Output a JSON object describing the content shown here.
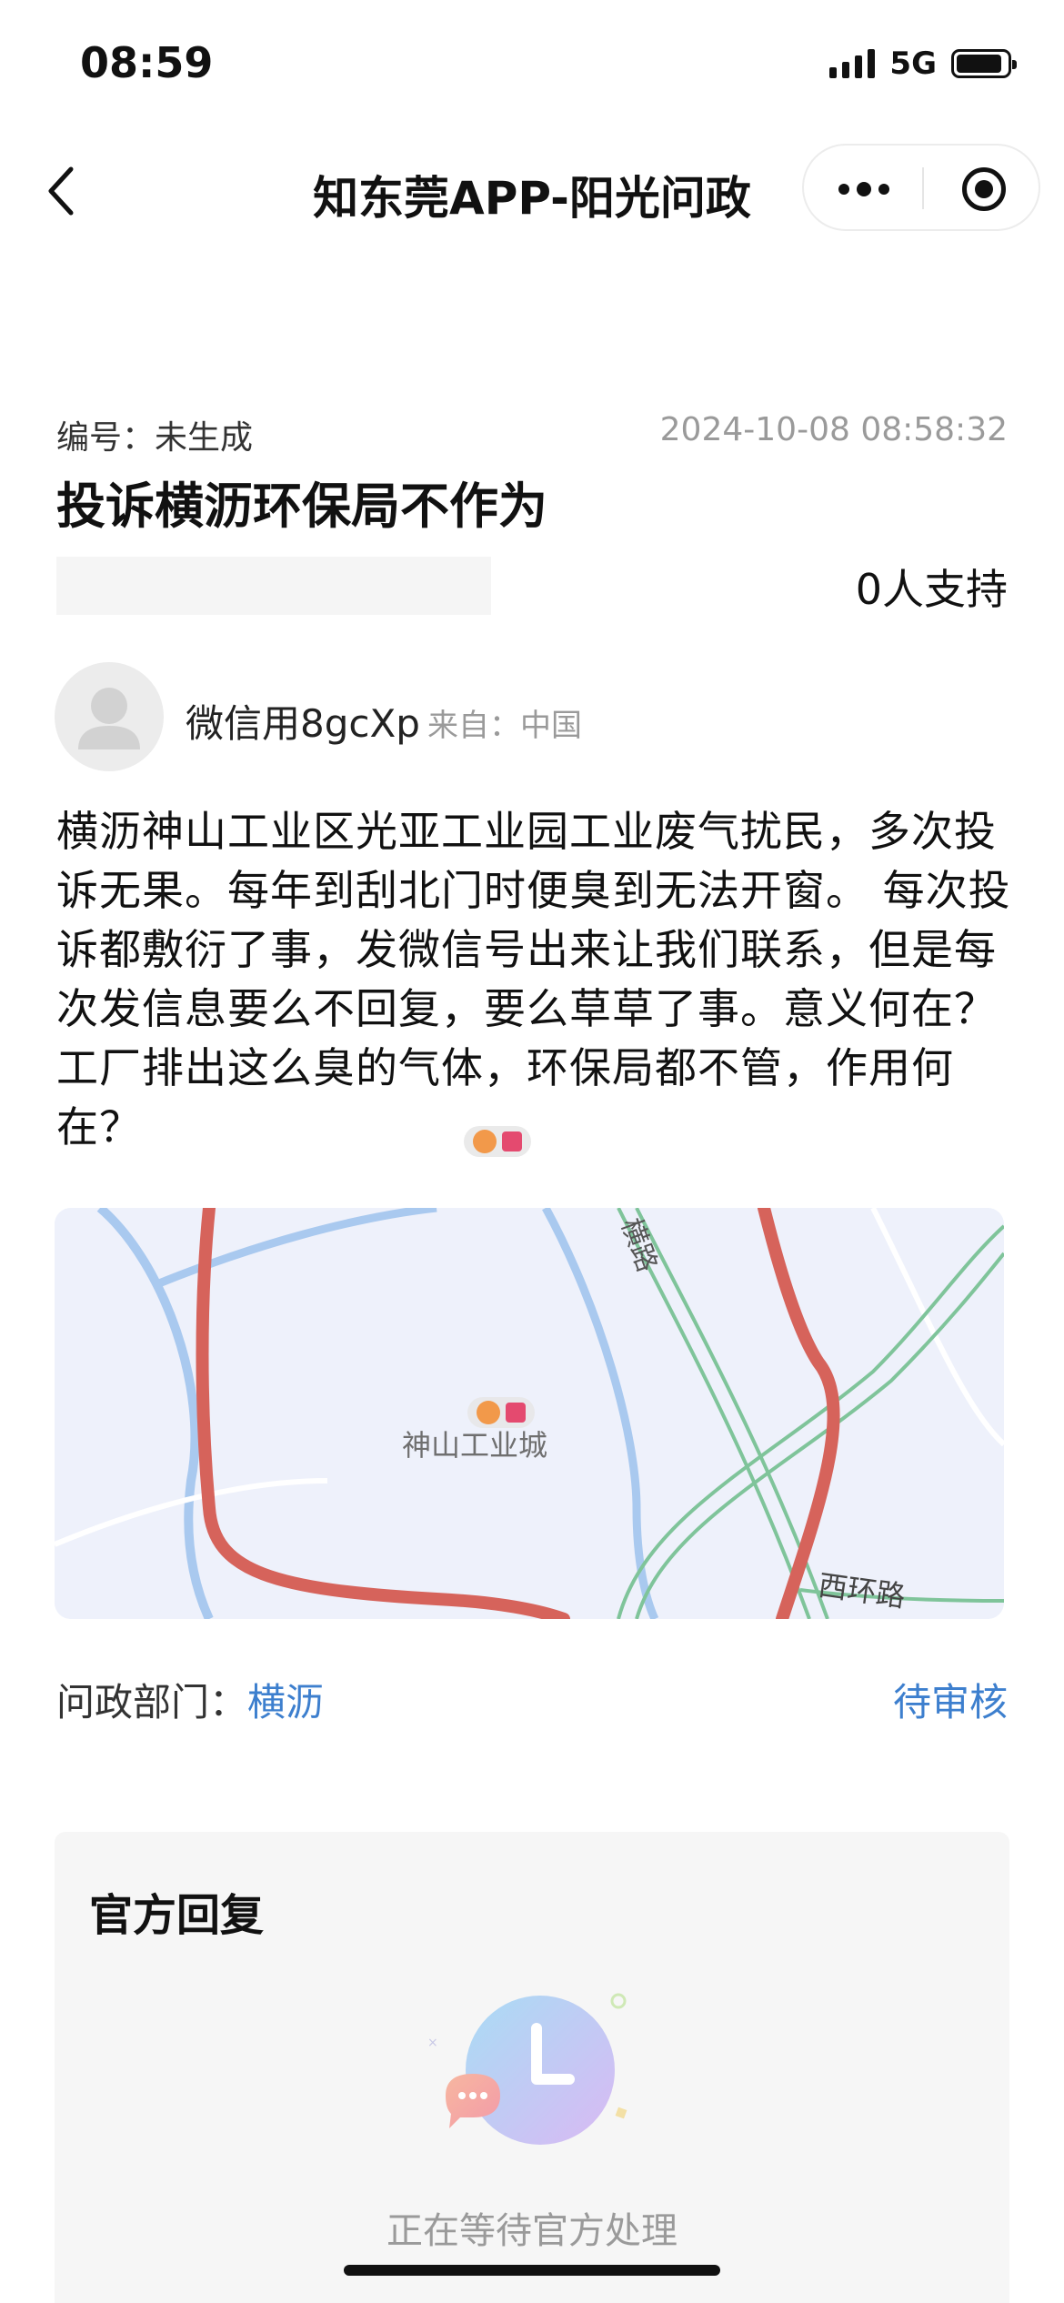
{
  "status_bar": {
    "time": "08:59",
    "network": "5G",
    "battery_level": 0.9
  },
  "nav": {
    "title": "知东莞APP-阳光问政"
  },
  "post": {
    "serial": "编号：未生成",
    "datetime": "2024-10-08 08:58:32",
    "title": "投诉横沥环保局不作为",
    "support": "0人支持"
  },
  "user": {
    "name": "微信用8gcXp",
    "from": "来自：中国"
  },
  "content": "横沥神山工业区光亚工业园工业废气扰民，多次投诉无果。每年到刮北门时便臭到无法开窗。 每次投诉都敷衍了事，发微信号出来让我们联系，但是每次发信息要么不回复，要么草草了事。意义何在？ 工厂排出这么臭的气体，环保局都不管，作用何在？",
  "map": {
    "place": "神山工业城",
    "road_1": "横路",
    "road_2": "西环路"
  },
  "department": {
    "label": "问政部门：",
    "value": "横沥",
    "status": "待审核"
  },
  "reply": {
    "title": "官方回复",
    "status": "正在等待官方处理"
  },
  "colors": {
    "accent": "#3d7fce",
    "route": "#d6635b",
    "map_bg": "#eef1fb"
  }
}
